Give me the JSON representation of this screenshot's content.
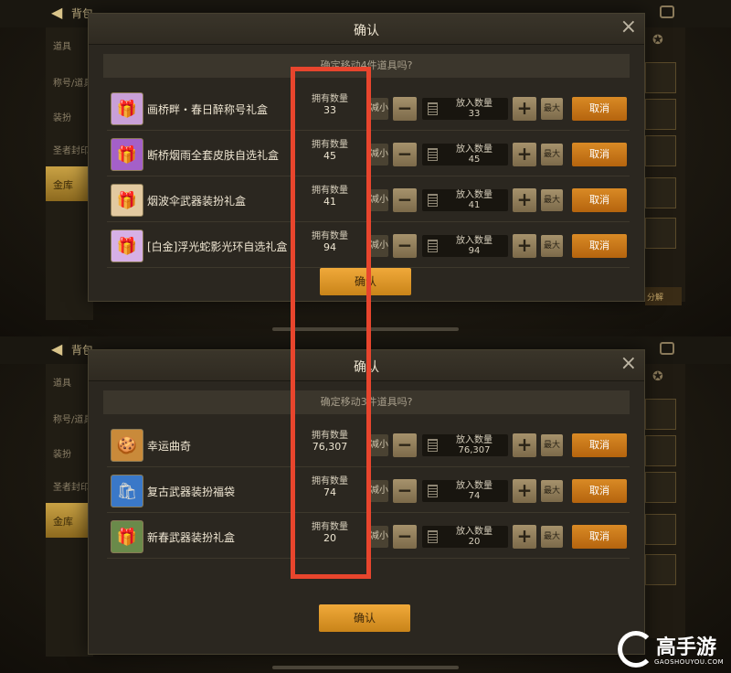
{
  "bg": {
    "back_icon": "back-arrow-icon",
    "title": "背包",
    "tabs": [
      "道具",
      "称号/道具",
      "装扮",
      "圣者封印"
    ],
    "gold_tab": "金库",
    "split_label": "分解"
  },
  "dialog1": {
    "title": "确认",
    "close": "×",
    "subtitle": "确定移动4件道具吗?",
    "confirm": "确认",
    "items": [
      {
        "name": "画桥畔・春日醉称号礼盒",
        "icon": "title-gift-box-icon",
        "icon_color": "#c9a0d8",
        "own_label": "拥有数量",
        "own": "33",
        "min": "减小",
        "put_label": "放入数量",
        "put": "33",
        "max": "最大",
        "cancel": "取消"
      },
      {
        "name": "断桥烟雨全套皮肤自选礼盒",
        "icon": "skin-gift-box-icon",
        "icon_color": "#a460c8",
        "own_label": "拥有数量",
        "own": "45",
        "min": "减小",
        "put_label": "放入数量",
        "put": "45",
        "max": "最大",
        "cancel": "取消"
      },
      {
        "name": "烟波伞武器装扮礼盒",
        "icon": "weapon-gift-box-icon",
        "icon_color": "#e2c9a0",
        "own_label": "拥有数量",
        "own": "41",
        "min": "减小",
        "put_label": "放入数量",
        "put": "41",
        "max": "最大",
        "cancel": "取消"
      },
      {
        "name": "[白金]浮光蛇影光环自选礼盒",
        "icon": "aura-gift-box-icon",
        "icon_color": "#d6b0e6",
        "own_label": "拥有数量",
        "own": "94",
        "min": "减小",
        "put_label": "放入数量",
        "put": "94",
        "max": "最大",
        "cancel": "取消"
      }
    ]
  },
  "dialog2": {
    "title": "确认",
    "close": "×",
    "subtitle": "确定移动3件道具吗?",
    "confirm": "确认",
    "items": [
      {
        "name": "幸运曲奇",
        "icon": "lucky-cookie-icon",
        "icon_color": "#c98a3a",
        "own_label": "拥有数量",
        "own": "76,307",
        "min": "减小",
        "put_label": "放入数量",
        "put": "76,307",
        "max": "最大",
        "cancel": "取消"
      },
      {
        "name": "复古武器装扮福袋",
        "icon": "lucky-bag-icon",
        "icon_color": "#3a78c8",
        "own_label": "拥有数量",
        "own": "74",
        "min": "减小",
        "put_label": "放入数量",
        "put": "74",
        "max": "最大",
        "cancel": "取消"
      },
      {
        "name": "新春武器装扮礼盒",
        "icon": "spring-gift-box-icon",
        "icon_color": "#6a8a4a",
        "own_label": "拥有数量",
        "own": "20",
        "min": "减小",
        "put_label": "放入数量",
        "put": "20",
        "max": "最大",
        "cancel": "取消"
      }
    ]
  },
  "watermark": {
    "text": "高手游",
    "sub": "GAOSHOUYOU.COM"
  },
  "colors": {
    "accent": "#e8452d",
    "cancel": "#d98a25",
    "confirm": "#f0a93a"
  }
}
